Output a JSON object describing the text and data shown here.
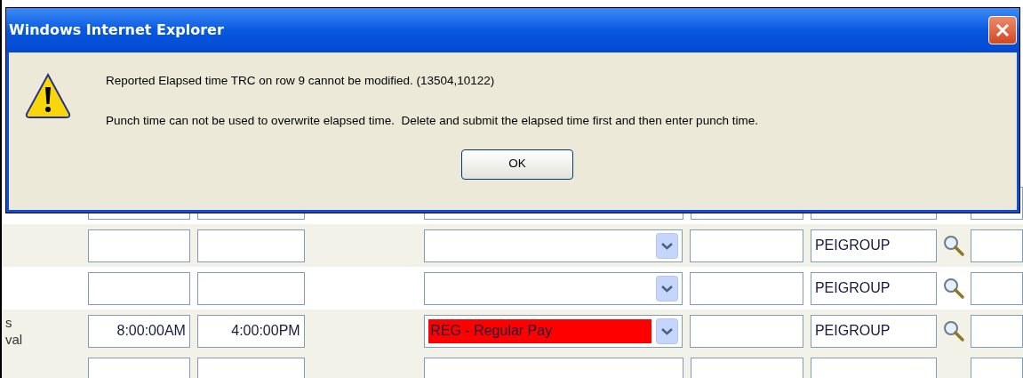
{
  "dialog": {
    "title": "Windows Internet Explorer",
    "messages": [
      "Reported Elapsed time TRC on row 9 cannot be modified. (13504,10122)",
      "Punch time can not be used to overwrite elapsed time.  Delete and submit the elapsed time first and then enter punch time."
    ],
    "button": "OK"
  },
  "rows": [
    {
      "kind": "partial"
    },
    {
      "kind": "full",
      "group": "PEIGROUP"
    },
    {
      "kind": "full",
      "group": "PEIGROUP"
    },
    {
      "kind": "full",
      "label_lines": [
        "s",
        "val"
      ],
      "in_time": "8:00:00AM",
      "out_time": "4:00:00PM",
      "trc": {
        "value": "REG - Regular Pay",
        "error": true
      },
      "group": "PEIGROUP"
    },
    {
      "kind": "partial"
    }
  ]
}
